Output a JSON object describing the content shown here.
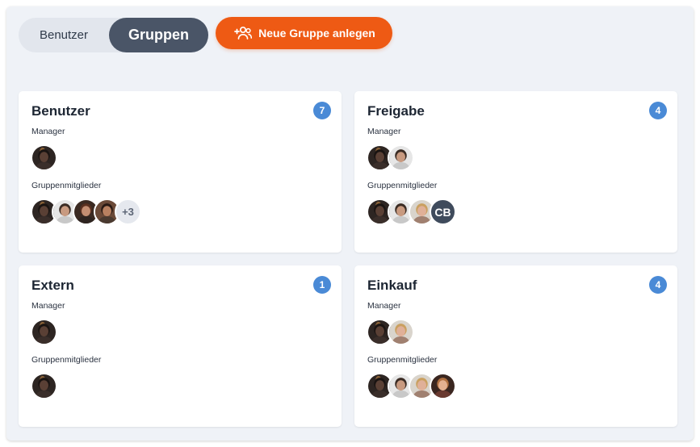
{
  "toolbar": {
    "tab_users": "Benutzer",
    "tab_groups": "Gruppen",
    "active_tab": "Gruppen",
    "create_group_label": "Neue Gruppe anlegen"
  },
  "colors": {
    "accent": "#ee5a14",
    "badge": "#4a8ad6",
    "active_tab": "#4a5567"
  },
  "labels": {
    "manager": "Manager",
    "members": "Gruppenmitglieder"
  },
  "groups": [
    {
      "name": "Benutzer",
      "count": "7",
      "managers": [
        "photo-dark"
      ],
      "members": [
        "photo-dark",
        "photo-man-beard",
        "photo-woman-brown",
        "photo-man-dark"
      ],
      "more": "+3",
      "initials": ""
    },
    {
      "name": "Freigabe",
      "count": "4",
      "managers": [
        "photo-dark",
        "photo-man-beard"
      ],
      "members": [
        "photo-dark",
        "photo-man-beard",
        "photo-woman-blonde"
      ],
      "more": "",
      "initials": "CB"
    },
    {
      "name": "Extern",
      "count": "1",
      "managers": [
        "photo-dark"
      ],
      "members": [
        "photo-dark"
      ],
      "more": "",
      "initials": ""
    },
    {
      "name": "Einkauf",
      "count": "4",
      "managers": [
        "photo-dark",
        "photo-woman-blonde"
      ],
      "members": [
        "photo-dark",
        "photo-man-beard",
        "photo-woman-blonde",
        "photo-woman-smile"
      ],
      "more": "",
      "initials": ""
    }
  ]
}
